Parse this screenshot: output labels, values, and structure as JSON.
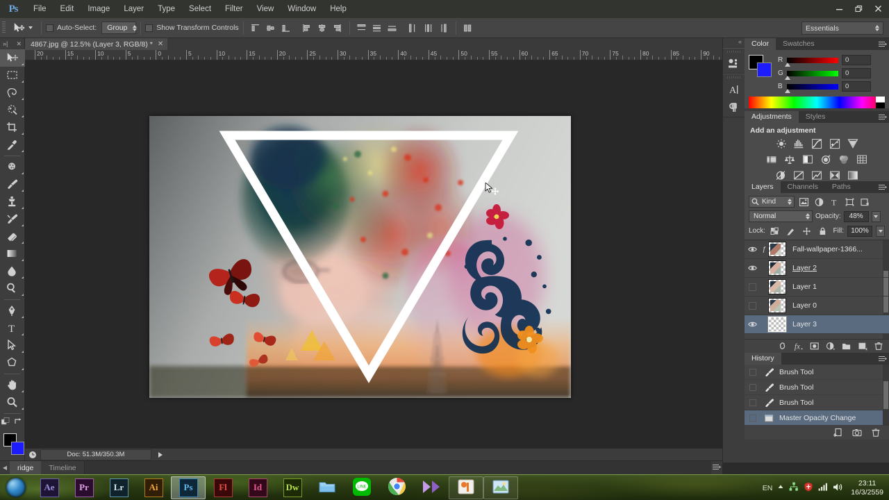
{
  "app": {
    "name": "Ps",
    "logo": "Ps"
  },
  "menubar": {
    "items": [
      "File",
      "Edit",
      "Image",
      "Layer",
      "Type",
      "Select",
      "Filter",
      "View",
      "Window",
      "Help"
    ],
    "window_buttons": {
      "minimize": "–",
      "restore": "❐",
      "close": "✕"
    }
  },
  "options_bar": {
    "tool_icon": "move-tool-icon",
    "auto_select_label": "Auto-Select:",
    "auto_select_value": "Group",
    "show_transform_label": "Show Transform Controls",
    "align_left_edges": "align-left-edges-icon",
    "align_horizontal_centers": "align-horizontal-centers-icon",
    "align_right_edges": "align-right-edges-icon",
    "align_top_edges": "align-top-edges-icon",
    "align_vertical_centers": "align-vertical-centers-icon",
    "align_bottom_edges": "align-bottom-edges-icon",
    "distribute_top": "distribute-top-edges-icon",
    "distribute_vcenter": "distribute-vertical-centers-icon",
    "distribute_bottom": "distribute-bottom-edges-icon",
    "distribute_left": "distribute-left-edges-icon",
    "distribute_hcenter": "distribute-horizontal-centers-icon",
    "distribute_right": "distribute-right-edges-icon",
    "auto_align": "auto-align-layers-icon",
    "workspace": "Essentials"
  },
  "toolbar": {
    "tools": [
      {
        "name": "move-tool",
        "sel": true
      },
      {
        "name": "rectangular-marquee-tool",
        "sel": false
      },
      {
        "name": "lasso-tool",
        "sel": false
      },
      {
        "name": "quick-selection-tool",
        "sel": false
      },
      {
        "name": "crop-tool",
        "sel": false
      },
      {
        "name": "eyedropper-tool",
        "sel": false
      },
      {
        "name": "spot-healing-brush-tool",
        "sel": false
      },
      {
        "name": "brush-tool",
        "sel": false
      },
      {
        "name": "clone-stamp-tool",
        "sel": false
      },
      {
        "name": "history-brush-tool",
        "sel": false
      },
      {
        "name": "eraser-tool",
        "sel": false
      },
      {
        "name": "gradient-tool",
        "sel": false
      },
      {
        "name": "blur-tool",
        "sel": false
      },
      {
        "name": "dodge-tool",
        "sel": false
      },
      {
        "name": "pen-tool",
        "sel": false
      },
      {
        "name": "horizontal-type-tool",
        "sel": false
      },
      {
        "name": "path-selection-tool",
        "sel": false
      },
      {
        "name": "polygon-tool",
        "sel": false
      },
      {
        "name": "hand-tool",
        "sel": false
      },
      {
        "name": "zoom-tool",
        "sel": false
      }
    ],
    "foreground_color": "#000000",
    "background_color": "#1c1cff",
    "quick_mask": "quick-mask-mode-icon"
  },
  "document": {
    "tab_title": "4867.jpg @ 12.5% (Layer 3, RGB/8) *",
    "close_label": "✕",
    "ruler_unit_labels": [
      "20",
      "15",
      "10",
      "5",
      "0",
      "5",
      "10",
      "15",
      "20",
      "25",
      "30",
      "35",
      "40",
      "45",
      "50",
      "55",
      "60",
      "65",
      "70",
      "75",
      "80",
      "85",
      "90"
    ]
  },
  "status_bar": {
    "doc_info": "Doc: 51.3M/350.3M",
    "zoom_icon": "clock-icon"
  },
  "bottom_tabs": {
    "items": [
      {
        "label": "ridge",
        "active": true
      },
      {
        "label": "Timeline",
        "active": false
      }
    ]
  },
  "rail": {
    "collapse_icon": "collapse-to-icons-icon",
    "buttons": [
      {
        "name": "mini-bridge-icon"
      },
      {
        "name": "character-panel-icon"
      },
      {
        "name": "paragraph-panel-icon"
      }
    ]
  },
  "color_panel": {
    "tabs": [
      {
        "label": "Color",
        "active": true
      },
      {
        "label": "Swatches",
        "active": false
      }
    ],
    "menu_icon": "panel-menu-icon",
    "channels": [
      {
        "label": "R",
        "value": "0",
        "color": "#ff0000"
      },
      {
        "label": "G",
        "value": "0",
        "color": "#00ff00"
      },
      {
        "label": "B",
        "value": "0",
        "color": "#0000ff"
      }
    ],
    "foreground": "#000000",
    "background": "#1c1cff"
  },
  "adjustments_panel": {
    "tabs": [
      {
        "label": "Adjustments",
        "active": true
      },
      {
        "label": "Styles",
        "active": false
      }
    ],
    "heading": "Add an adjustment",
    "icons": [
      "brightness-contrast-icon",
      "levels-icon",
      "curves-icon",
      "exposure-icon",
      "vibrance-icon",
      "hue-saturation-icon",
      "color-balance-icon",
      "black-white-icon",
      "photo-filter-icon",
      "channel-mixer-icon",
      "color-lookup-icon",
      "invert-icon",
      "posterize-icon",
      "threshold-icon",
      "selective-color-icon",
      "gradient-map-icon"
    ]
  },
  "layers_panel": {
    "tabs": [
      {
        "label": "Layers",
        "active": true
      },
      {
        "label": "Channels",
        "active": false
      },
      {
        "label": "Paths",
        "active": false
      }
    ],
    "menu_icon": "panel-menu-icon",
    "filter_label": "Kind",
    "filter_icons": [
      "filter-pixel-icon",
      "filter-adjustment-icon",
      "filter-type-icon",
      "filter-shape-icon",
      "filter-smart-object-icon"
    ],
    "blend_mode": "Normal",
    "opacity_label": "Opacity:",
    "opacity_value": "48%",
    "lock_label": "Lock:",
    "lock_icons": [
      "lock-transparent-pixels-icon",
      "lock-image-pixels-icon",
      "lock-position-icon",
      "lock-all-icon"
    ],
    "fill_label": "Fill:",
    "fill_value": "100%",
    "layers": [
      {
        "name": "Fall-wallpaper-1366...",
        "visible": true,
        "selected": false,
        "fx": true,
        "underline": false,
        "mask": false
      },
      {
        "name": "Layer 2",
        "visible": true,
        "selected": false,
        "fx": false,
        "underline": true,
        "mask": false
      },
      {
        "name": "Layer 1",
        "visible": false,
        "selected": false,
        "fx": false,
        "underline": false,
        "mask": false
      },
      {
        "name": "Layer 0",
        "visible": false,
        "selected": false,
        "fx": false,
        "underline": false,
        "mask": false
      },
      {
        "name": "Layer 3",
        "visible": true,
        "selected": true,
        "fx": false,
        "underline": false,
        "mask": true
      }
    ],
    "footer_icons": [
      "link-layers-icon",
      "add-layer-style-icon",
      "add-layer-mask-icon",
      "new-adjustment-layer-icon",
      "new-group-icon",
      "new-layer-icon",
      "delete-layer-icon"
    ]
  },
  "history_panel": {
    "tabs": [
      {
        "label": "History",
        "active": true
      }
    ],
    "menu_icon": "panel-menu-icon",
    "states": [
      {
        "label": "Brush Tool",
        "icon": "brush-tool-icon",
        "selected": false
      },
      {
        "label": "Brush Tool",
        "icon": "brush-tool-icon",
        "selected": false
      },
      {
        "label": "Brush Tool",
        "icon": "brush-tool-icon",
        "selected": false
      },
      {
        "label": "Master Opacity Change",
        "icon": "layer-icon",
        "selected": true
      }
    ],
    "footer_icons": [
      "new-document-from-state-icon",
      "new-snapshot-icon",
      "delete-state-icon"
    ]
  },
  "canvas": {
    "cursor": "move-cursor",
    "artboard_description": "double-exposure photo composite with white triangle outline, butterflies, floral swirls and Eiffel Tower"
  },
  "taskbar": {
    "start_button": "windows-start-orb",
    "items": [
      {
        "label": "Ae",
        "name": "after-effects",
        "color": "#9a8fd8",
        "bg": "#1d1436",
        "border": "#6b5ca8",
        "active": false,
        "frame": false
      },
      {
        "label": "Pr",
        "name": "premiere-pro",
        "color": "#e0a3e8",
        "bg": "#2a0d2e",
        "border": "#9b5ba8",
        "active": false,
        "frame": false
      },
      {
        "label": "Lr",
        "name": "lightroom",
        "color": "#cfe8f2",
        "bg": "#10222b",
        "border": "#5b93a8",
        "active": false,
        "frame": false
      },
      {
        "label": "Ai",
        "name": "illustrator",
        "color": "#f0a43a",
        "bg": "#301f06",
        "border": "#b07a20",
        "active": false,
        "frame": false
      },
      {
        "label": "Ps",
        "name": "photoshop",
        "color": "#62b7e8",
        "bg": "#0d2638",
        "border": "#3e86b5",
        "active": true,
        "frame": false
      },
      {
        "label": "Fl",
        "name": "flash",
        "color": "#e8504a",
        "bg": "#3a0808",
        "border": "#a63a34",
        "active": false,
        "frame": false
      },
      {
        "label": "Id",
        "name": "indesign",
        "color": "#e8578f",
        "bg": "#33081a",
        "border": "#a8476b",
        "active": false,
        "frame": false
      },
      {
        "label": "Dw",
        "name": "dreamweaver",
        "color": "#b4e04a",
        "bg": "#1d2a06",
        "border": "#7a9a28",
        "active": false,
        "frame": false
      },
      {
        "label": "",
        "name": "folder-icon",
        "color": "#7ec0ee",
        "bg": "transparent",
        "border": "transparent",
        "active": false,
        "frame": false
      },
      {
        "label": "LINE",
        "name": "line-app-icon",
        "color": "#ffffff",
        "bg": "#00b900",
        "border": "#00b900",
        "active": false,
        "frame": false
      },
      {
        "label": "",
        "name": "chrome-icon",
        "color": "#ffffff",
        "bg": "transparent",
        "border": "transparent",
        "active": false,
        "frame": false
      },
      {
        "label": "",
        "name": "media-player-icon",
        "color": "#b07ae0",
        "bg": "transparent",
        "border": "transparent",
        "active": false,
        "frame": false
      },
      {
        "label": "",
        "name": "photo-viewer-icon",
        "color": "#e8792a",
        "bg": "transparent",
        "border": "transparent",
        "active": false,
        "frame": true
      },
      {
        "label": "",
        "name": "picture-window-icon",
        "color": "#7ec0ee",
        "bg": "transparent",
        "border": "transparent",
        "active": false,
        "frame": true
      }
    ],
    "tray": {
      "language": "EN",
      "show_hidden": "show-hidden-icons-arrow",
      "icons": [
        "network-share-icon",
        "antivirus-icon",
        "signal-bars-icon",
        "volume-icon"
      ],
      "time": "23:11",
      "date": "16/3/2559"
    }
  }
}
